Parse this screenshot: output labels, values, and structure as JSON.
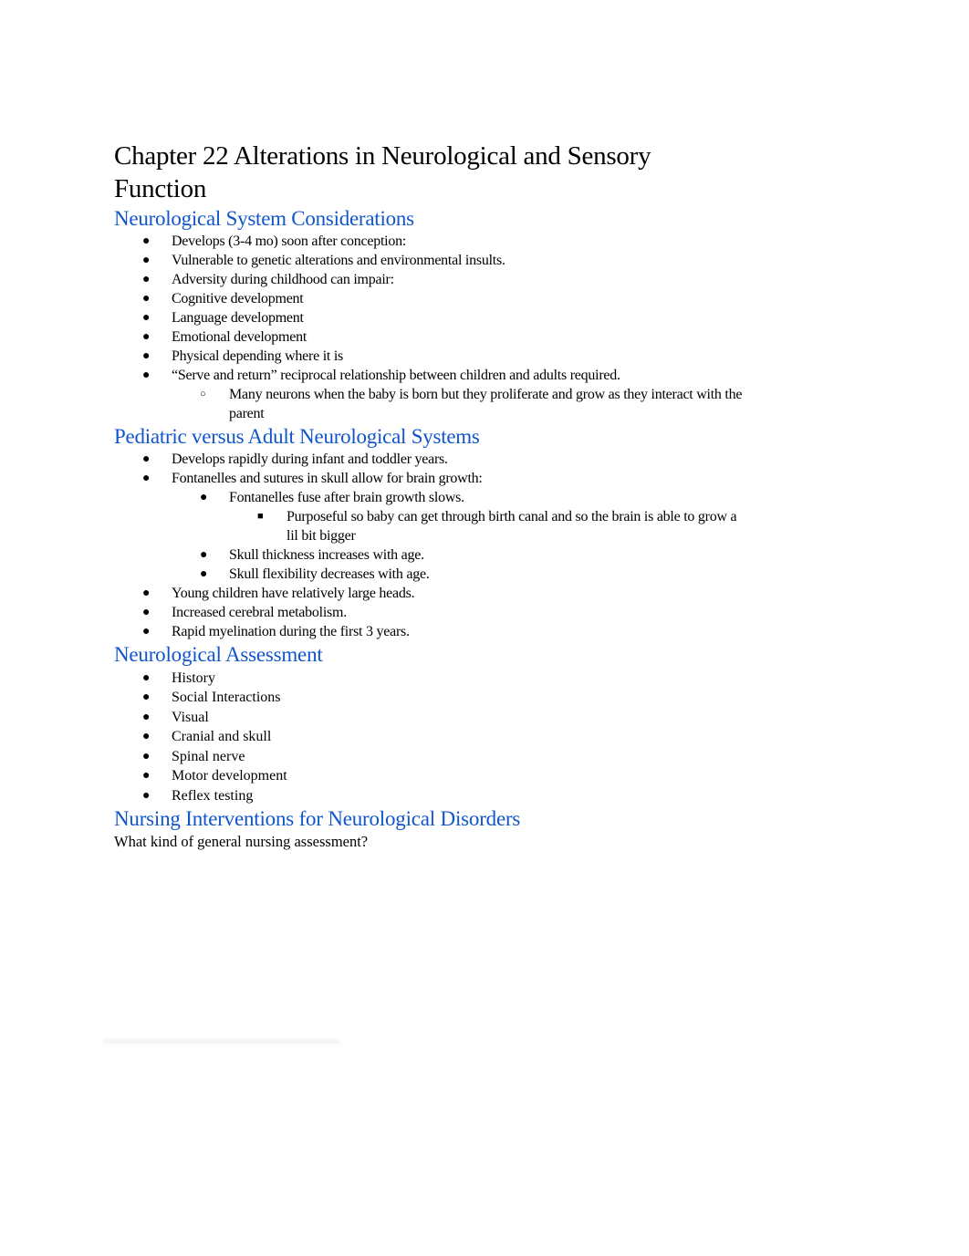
{
  "document": {
    "title": "Chapter 22 Alterations in Neurological and Sensory Function",
    "heading_color": "#1155cc",
    "sections": [
      {
        "heading": "Neurological System Considerations",
        "items": [
          {
            "level": 1,
            "bullet": "●",
            "text": "Develops (3-4 mo) soon after conception:"
          },
          {
            "level": 1,
            "bullet": "●",
            "text": "Vulnerable to genetic alterations and environmental insults."
          },
          {
            "level": 1,
            "bullet": "●",
            "text": "Adversity during childhood can impair:"
          },
          {
            "level": 1,
            "bullet": "●",
            "text": "Cognitive development"
          },
          {
            "level": 1,
            "bullet": "●",
            "text": "Language development"
          },
          {
            "level": 1,
            "bullet": "●",
            "text": "Emotional development"
          },
          {
            "level": 1,
            "bullet": "●",
            "text": "Physical depending where it is"
          },
          {
            "level": 1,
            "bullet": "●",
            "text": "“Serve and return” reciprocal relationship between children and adults required."
          },
          {
            "level": 2,
            "bullet": "○",
            "text": "Many neurons when the baby is born but they proliferate and grow as they interact with the parent"
          }
        ]
      },
      {
        "heading": "Pediatric versus Adult Neurological Systems",
        "items": [
          {
            "level": 1,
            "bullet": "●",
            "text": "Develops rapidly during infant and toddler years."
          },
          {
            "level": 1,
            "bullet": "●",
            "text": "Fontanelles and sutures in skull allow for brain growth:"
          },
          {
            "level": 2,
            "bullet": "●",
            "text": "Fontanelles fuse after brain growth slows."
          },
          {
            "level": 3,
            "bullet": "■",
            "text": "Purposeful so baby can get through birth canal and so the brain is able to grow a lil bit bigger"
          },
          {
            "level": 2,
            "bullet": "●",
            "text": "Skull thickness increases with age."
          },
          {
            "level": 2,
            "bullet": "●",
            "text": "Skull flexibility decreases with age."
          },
          {
            "level": 1,
            "bullet": "●",
            "text": "Young children have relatively large heads."
          },
          {
            "level": 1,
            "bullet": "●",
            "text": "Increased cerebral metabolism."
          },
          {
            "level": 1,
            "bullet": "●",
            "text": "Rapid myelination during the first 3 years."
          }
        ]
      },
      {
        "heading": "Neurological Assessment",
        "items": [
          {
            "level": 1,
            "bullet": "●",
            "text": "History"
          },
          {
            "level": 1,
            "bullet": "●",
            "text": "Social Interactions"
          },
          {
            "level": 1,
            "bullet": "●",
            "text": "Visual"
          },
          {
            "level": 1,
            "bullet": "●",
            "text": "Cranial and skull"
          },
          {
            "level": 1,
            "bullet": "●",
            "text": "Spinal nerve"
          },
          {
            "level": 1,
            "bullet": "●",
            "text": "Motor development"
          },
          {
            "level": 1,
            "bullet": "●",
            "text": "Reflex testing"
          }
        ]
      },
      {
        "heading": "Nursing Interventions for Neurological Disorders",
        "paragraph": "What kind of general nursing assessment?"
      }
    ]
  }
}
